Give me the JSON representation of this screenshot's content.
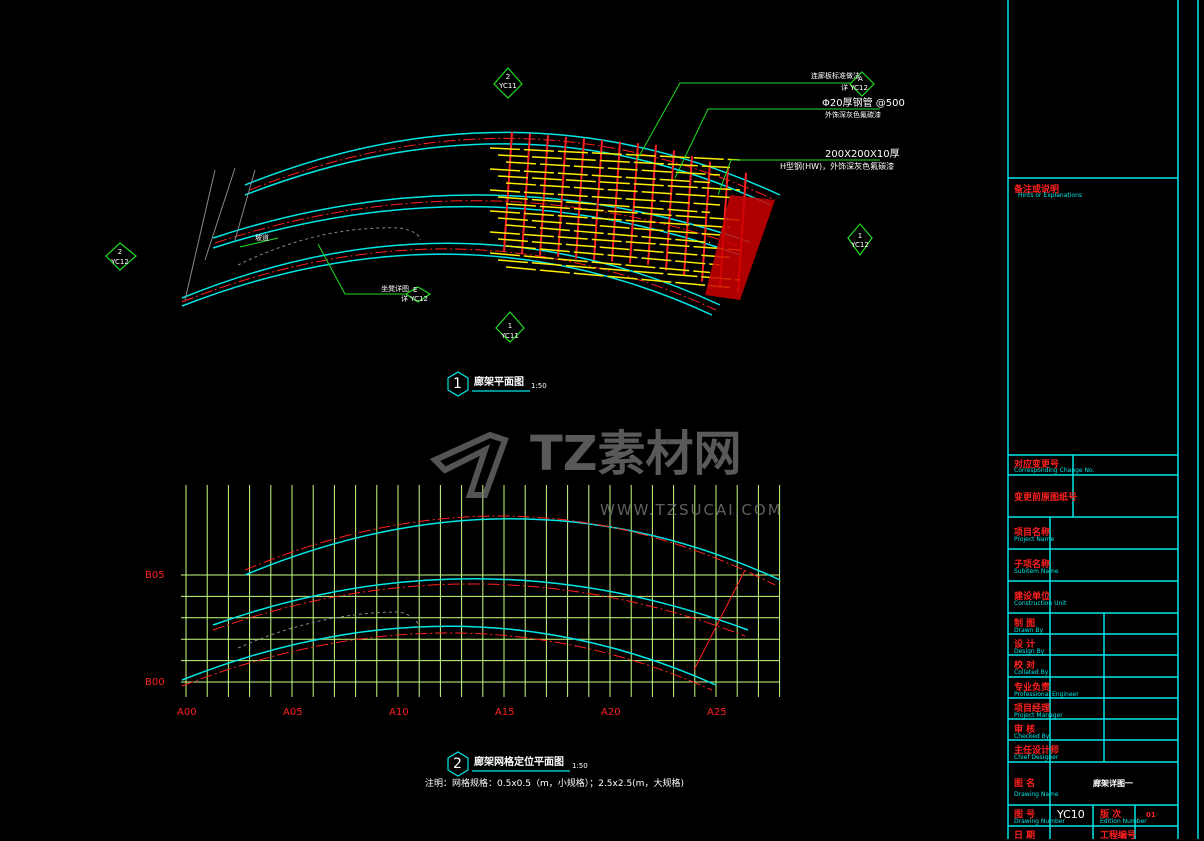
{
  "drawing1": {
    "number": "1",
    "title": "廊架平面图",
    "scale": "1:50",
    "callouts": [
      {
        "text": "连廊板标准做法",
        "ref_letter": "A",
        "ref_sheet": "详 YC12"
      },
      {
        "text": "Φ20厚钢管 @500",
        "sub": "外饰深灰色氟碳漆"
      },
      {
        "text": "200X200X10厚",
        "sub": "H型钢(HW)，外饰深灰色氟碳漆"
      },
      {
        "text": "坐凳详图",
        "ref_letter": "E",
        "ref_sheet": "详 YC12"
      }
    ],
    "arrow_label": "坡道",
    "section_marks": [
      {
        "num": "2",
        "sheet": "YC11"
      },
      {
        "num": "2",
        "sheet": "YC12"
      },
      {
        "num": "1",
        "sheet": "YC12"
      },
      {
        "num": "1",
        "sheet": "YC11"
      }
    ]
  },
  "drawing2": {
    "number": "2",
    "title": "廊架网格定位平面图",
    "scale": "1:50",
    "note": "注明：网格规格：0.5x0.5（m，小规格）；2.5x2.5(m，大规格)",
    "x_axis": [
      "A00",
      "A05",
      "A10",
      "A15",
      "A20",
      "A25"
    ],
    "y_axis": [
      "B05",
      "B00"
    ]
  },
  "watermark": {
    "text": "TZ素材网",
    "url_text": "WWW.TZSUCAI.COM"
  },
  "title_block": {
    "notes": {
      "cn": "备注或说明",
      "en": "Hints or Explanations"
    },
    "change": {
      "cn": "对应变更号",
      "en": "Corresponding Change No."
    },
    "replaced": {
      "cn": "变更前原图纸号"
    },
    "rows": [
      {
        "cn": "项目名称",
        "en": "Project Name"
      },
      {
        "cn": "子项名称",
        "en": "Subitem Name"
      },
      {
        "cn": "建设单位",
        "en": "Construction Unit"
      },
      {
        "cn": "制  图",
        "en": "Drawn By"
      },
      {
        "cn": "设  计",
        "en": "Design By"
      },
      {
        "cn": "校  对",
        "en": "Collated By"
      },
      {
        "cn": "专业负责",
        "en": "Professional Engineer"
      },
      {
        "cn": "项目经理",
        "en": "Project Manager"
      },
      {
        "cn": "审  核",
        "en": "Checked By"
      },
      {
        "cn": "主任设计师",
        "en": "Chief Designer"
      }
    ],
    "drawing_name": {
      "cn": "图  名",
      "en": "Drawing Name",
      "value": "廊架详图一"
    },
    "drawing_number": {
      "cn": "图  号",
      "en": "Drawing Number",
      "value": "YC10"
    },
    "edition": {
      "cn": "版  次",
      "en": "Edition Number",
      "value": "01"
    },
    "date": {
      "cn": "日  期"
    },
    "project_no": {
      "cn": "工程编号"
    }
  }
}
